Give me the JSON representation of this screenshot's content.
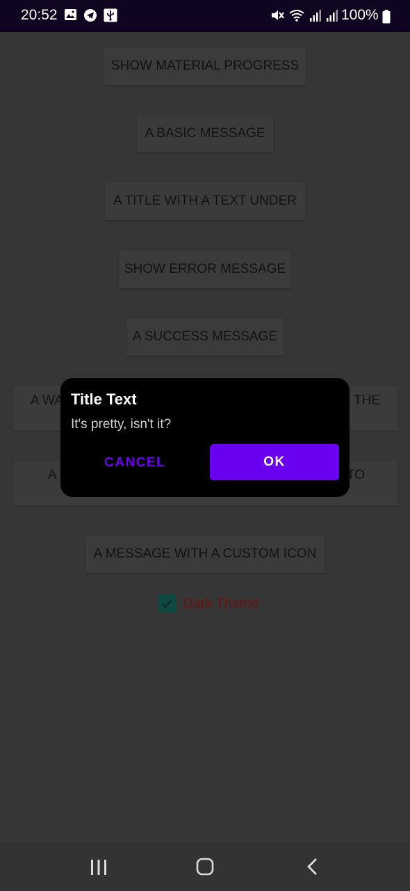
{
  "status_bar": {
    "time": "20:52",
    "battery": "100%",
    "left_icons": [
      "image-icon",
      "telegram-icon",
      "usb-icon"
    ],
    "right_icons": [
      "mute-icon",
      "wifi-icon",
      "signal-icon",
      "signal-icon",
      "battery-icon"
    ]
  },
  "buttons": {
    "show_material_progress": "SHOW MATERIAL PROGRESS",
    "basic_message": "A BASIC MESSAGE",
    "title_with_text_under": "A TITLE WITH A TEXT UNDER",
    "show_error_message": "SHOW ERROR MESSAGE",
    "success_message": "A SUCCESS MESSAGE",
    "warning_left": "A WA",
    "warning_right": "THE",
    "seventh_left": "A",
    "seventh_right": "TO",
    "custom_icon_message": "A MESSAGE WITH A CUSTOM ICON"
  },
  "dark_theme": {
    "label": "Dark Theme",
    "checked": true
  },
  "dialog": {
    "title": "Title Text",
    "body": "It's pretty, isn't it?",
    "cancel_label": "CANCEL",
    "ok_label": "OK"
  },
  "nav_bar": {
    "icons": [
      "recents-icon",
      "home-icon",
      "back-icon"
    ]
  },
  "colors": {
    "accent": "#6a00f0",
    "overlay_background": "#363636",
    "dialog_background": "#000000",
    "status_bar": "#0f0520"
  }
}
